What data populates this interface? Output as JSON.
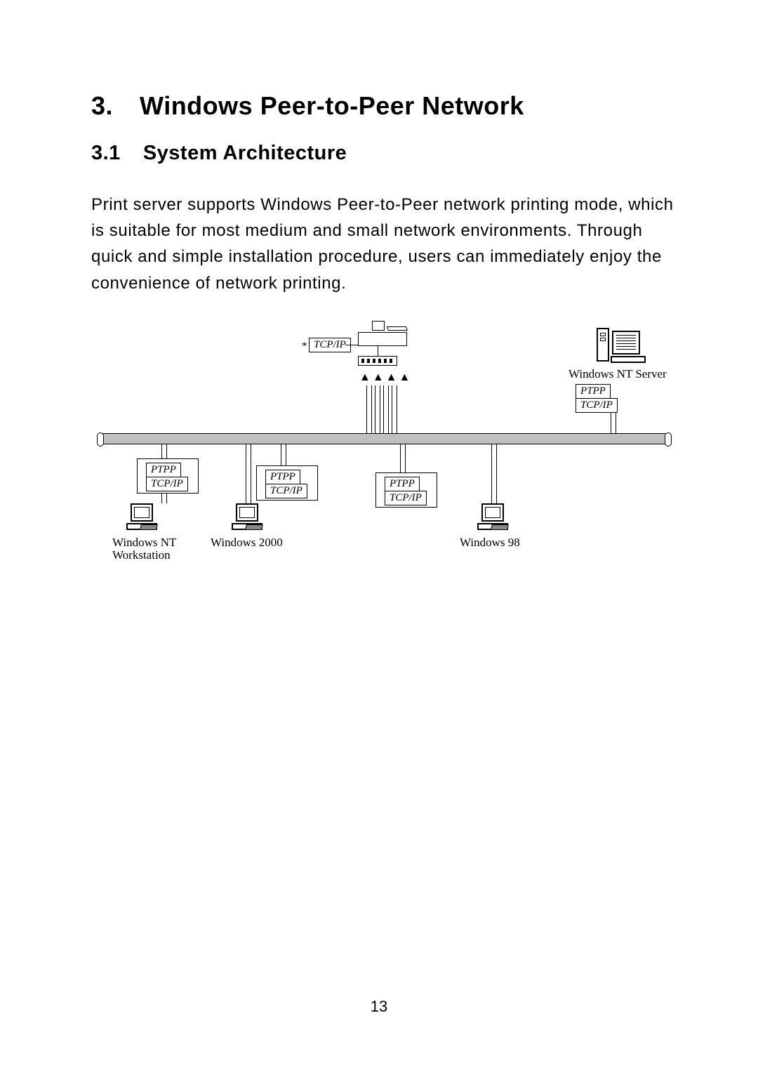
{
  "heading": {
    "number": "3.",
    "title": "Windows Peer-to-Peer Network"
  },
  "subheading": {
    "number": "3.1",
    "title": "System Architecture"
  },
  "paragraph": "Print server supports Windows Peer-to-Peer network printing mode, which is suitable for most medium and small network environments. Through quick and simple installation procedure, users can immediately enjoy the convenience of network printing.",
  "diagram": {
    "printserver_protocol_prefix": "*",
    "printserver_protocol": "TCP/IP",
    "server_label": "Windows NT Server",
    "server_tags": {
      "top": "PTPP",
      "bottom": "TCP/IP"
    },
    "clients": [
      {
        "label_line1": "Windows NT",
        "label_line2": "Workstation",
        "tags": {
          "top": "PTPP",
          "bottom": "TCP/IP"
        }
      },
      {
        "label_line1": "Windows 2000",
        "label_line2": "",
        "tags": {
          "top": "PTPP",
          "bottom": "TCP/IP"
        }
      },
      {
        "label_line1": "",
        "label_line2": "",
        "tags": {
          "top": "PTPP",
          "bottom": "TCP/IP"
        }
      },
      {
        "label_line1": "Windows 98",
        "label_line2": "",
        "tags": null
      }
    ],
    "arrows_glyph": "▲▲▲▲"
  },
  "page_number": "13"
}
